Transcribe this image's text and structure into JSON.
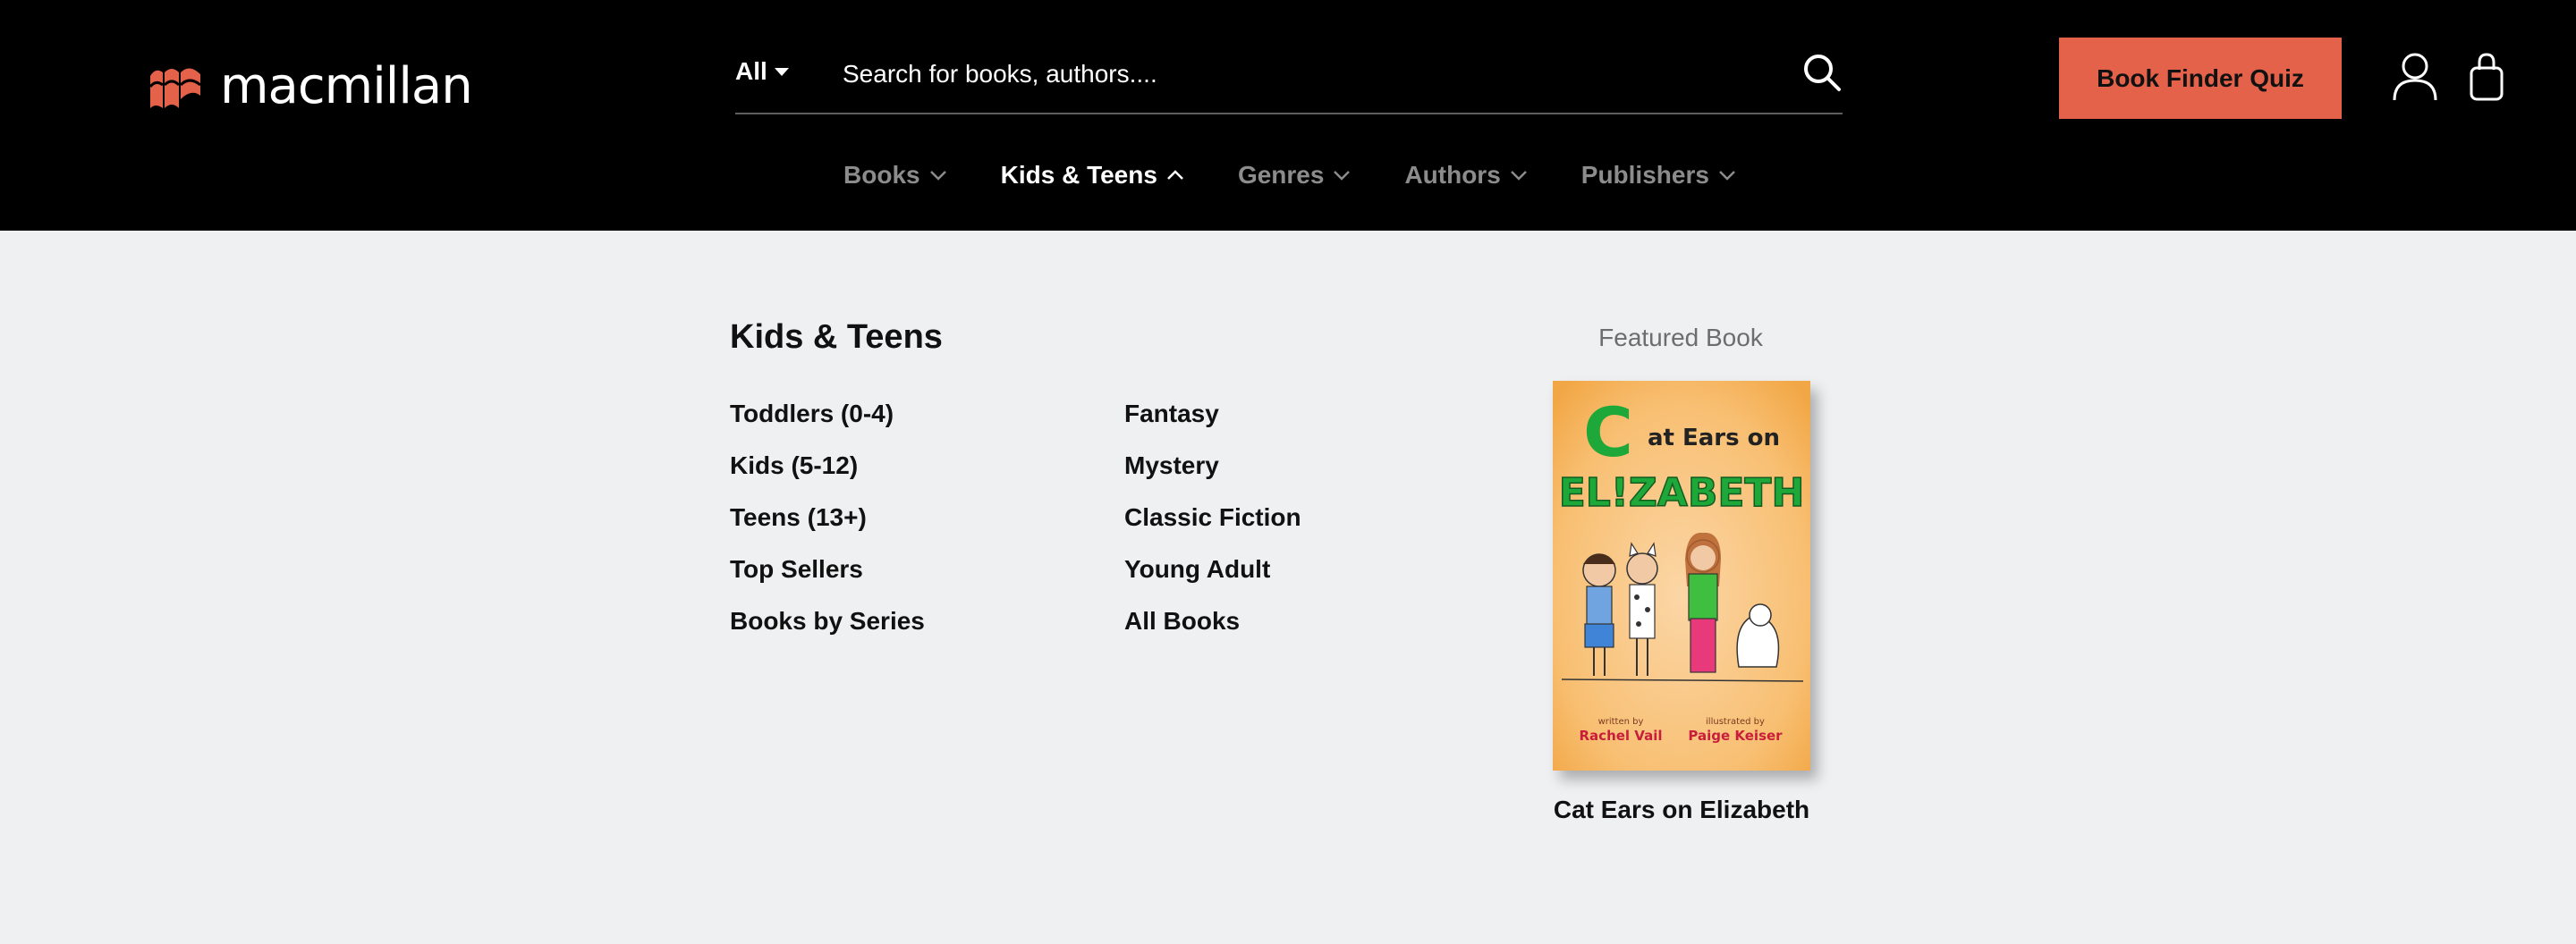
{
  "brand": {
    "name": "macmillan",
    "accent": "#e4614a"
  },
  "search": {
    "scope": "All",
    "placeholder": "Search for books, authors...."
  },
  "header": {
    "quiz_label": "Book Finder Quiz"
  },
  "nav": {
    "items": [
      {
        "label": "Books",
        "active": false
      },
      {
        "label": "Kids & Teens",
        "active": true
      },
      {
        "label": "Genres",
        "active": false
      },
      {
        "label": "Authors",
        "active": false
      },
      {
        "label": "Publishers",
        "active": false
      }
    ]
  },
  "dropdown": {
    "title": "Kids & Teens",
    "column1": [
      "Toddlers (0-4)",
      "Kids (5-12)",
      "Teens (13+)",
      "Top Sellers",
      "Books by Series"
    ],
    "column2": [
      "Fantasy",
      "Mystery",
      "Classic Fiction",
      "Young Adult",
      "All Books"
    ],
    "featured": {
      "label": "Featured Book",
      "title": "Cat Ears on Elizabeth",
      "cover": {
        "big_letter": "C",
        "title_line1": "at Ears on",
        "title_line2": "EL!ZABETH",
        "written_by": "written by",
        "author": "Rachel Vail",
        "illustrated_by": "illustrated by",
        "illustrator": "Paige Keiser"
      }
    }
  }
}
